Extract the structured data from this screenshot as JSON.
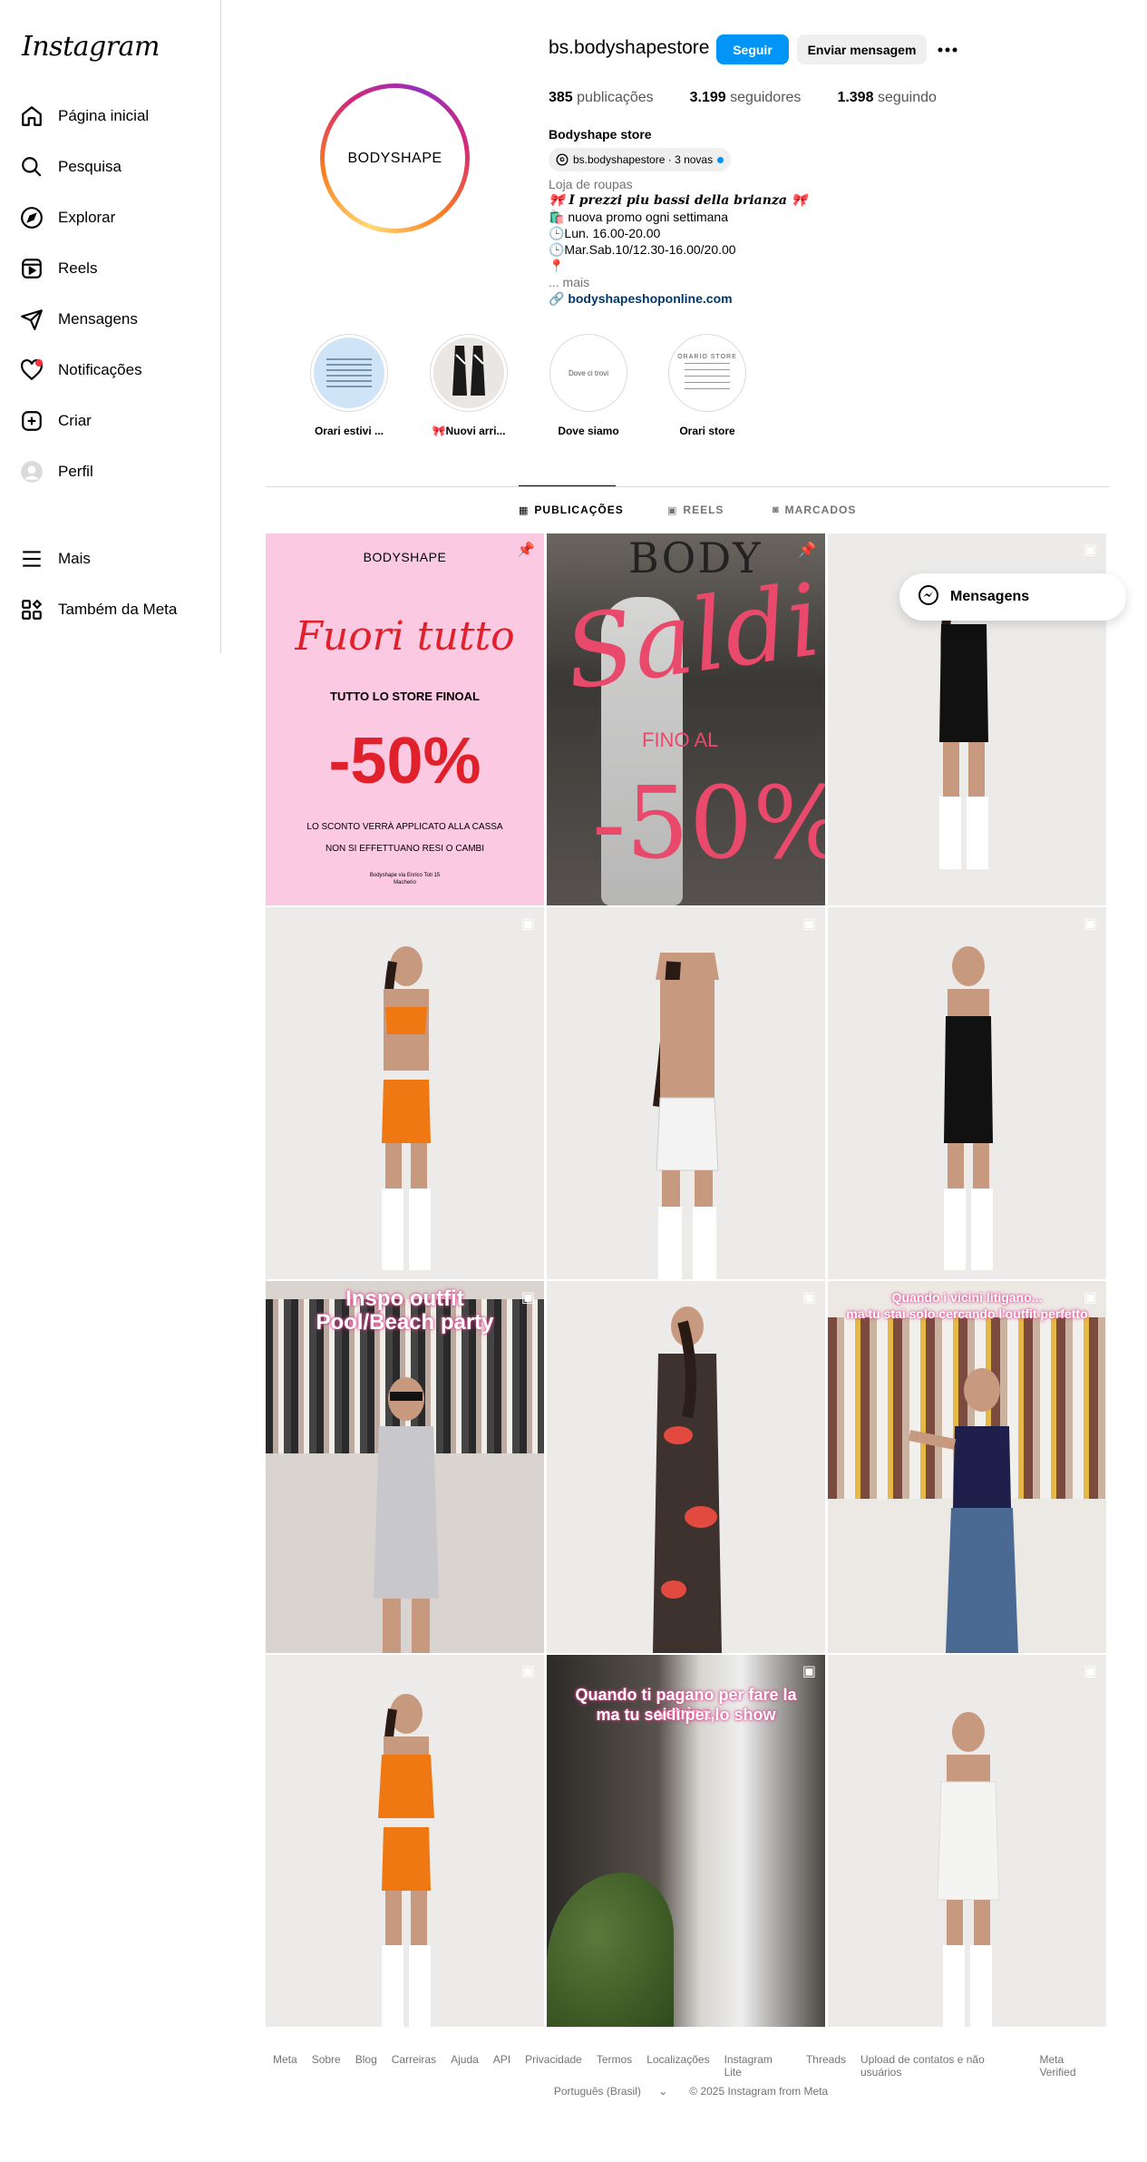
{
  "app": {
    "logo": "Instagram"
  },
  "sidebar": {
    "items": [
      {
        "label": "Página inicial",
        "icon": "home-icon"
      },
      {
        "label": "Pesquisa",
        "icon": "search-icon"
      },
      {
        "label": "Explorar",
        "icon": "compass-icon"
      },
      {
        "label": "Reels",
        "icon": "reels-icon"
      },
      {
        "label": "Mensagens",
        "icon": "paper-plane-icon"
      },
      {
        "label": "Notificações",
        "icon": "heart-icon"
      },
      {
        "label": "Criar",
        "icon": "plus-square-icon"
      },
      {
        "label": "Perfil",
        "icon": "avatar-icon"
      },
      {
        "label": "Mais",
        "icon": "hamburger-icon"
      },
      {
        "label": "Também da Meta",
        "icon": "meta-apps-icon"
      }
    ]
  },
  "profile": {
    "avatar_text": "BODYSHAPE",
    "username": "bs.bodyshapestore",
    "follow_label": "Seguir",
    "message_label": "Enviar mensagem",
    "posts_count": "385",
    "posts_label": "publicações",
    "followers_count": "3.199",
    "followers_label": "seguidores",
    "following_count": "1.398",
    "following_label": "seguindo",
    "full_name": "Bodyshape store",
    "threads_label": "bs.bodyshapestore · 3 novas",
    "category": "Loja de roupas",
    "bio_lines": [
      "🎀 𝑰 𝒑𝒓𝒆𝒛𝒛𝒊 𝒑𝒊𝒖 𝒃𝒂𝒔𝒔𝒊 𝒅𝒆𝒍𝒍𝒂 𝒃𝒓𝒊𝒂𝒏𝒛𝒂 🎀",
      "🛍️ nuova promo ogni settimana",
      "🕒Lun. 16.00-20.00",
      "🕒Mar.Sab.10/12.30-16.00/20.00",
      "📍"
    ],
    "more_label": "... mais",
    "link": "bodyshapeshoponline.com"
  },
  "highlights": [
    {
      "label": "Orari estivi ..."
    },
    {
      "label": "🎀Nuovi arri..."
    },
    {
      "label": "Dove siamo",
      "cover_text": "Dove ci trovi"
    },
    {
      "label": "Orari store",
      "cover_text": "ORARIO STORE"
    }
  ],
  "tabs": [
    {
      "label": "PUBLICAÇÕES",
      "icon": "grid-icon"
    },
    {
      "label": "REELS",
      "icon": "reels-icon"
    },
    {
      "label": "MARCADOS",
      "icon": "tagged-icon"
    }
  ],
  "posts": {
    "p1": {
      "brand": "BODYSHAPE",
      "script": "Fuori tutto",
      "subtitle": "TUTTO LO STORE FINOAL",
      "discount": "-50%",
      "note1": "LO SCONTO VERRÀ APPLICATO ALLA CASSA",
      "note2": "NON SI EFFETTUANO RESI O CAMBI",
      "address1": "Bodyshape via Enrico Toti 15",
      "address2": "Macherio"
    },
    "p2": {
      "sign1": "Saldi",
      "sign2": "FINO AL",
      "sign3": "-50%",
      "storefront": "BODY"
    },
    "p7": {
      "overlay1": "Inspo outfit",
      "overlay2": "Pool/Beach party"
    },
    "p9": {
      "overlay1": "Quando i vicini litigano...",
      "overlay2": "ma tu stai solo cercando l'outfit perfetto"
    },
    "p11": {
      "overlay1": "Quando ti pagano per fare la vetrina,",
      "overlay2": "ma tu sei lì per lo show"
    }
  },
  "messages_float": {
    "label": "Mensagens"
  },
  "footer": {
    "links": [
      "Meta",
      "Sobre",
      "Blog",
      "Carreiras",
      "Ajuda",
      "API",
      "Privacidade",
      "Termos",
      "Localizações",
      "Instagram Lite",
      "Threads",
      "Upload de contatos e não usuários",
      "Meta Verified"
    ],
    "language": "Português (Brasil)",
    "copyright": "© 2025 Instagram from Meta"
  },
  "colors": {
    "accent": "#0095f6",
    "notif": "#ff3040",
    "promo_pink": "#fcc9e3",
    "promo_red": "#e0202b"
  }
}
